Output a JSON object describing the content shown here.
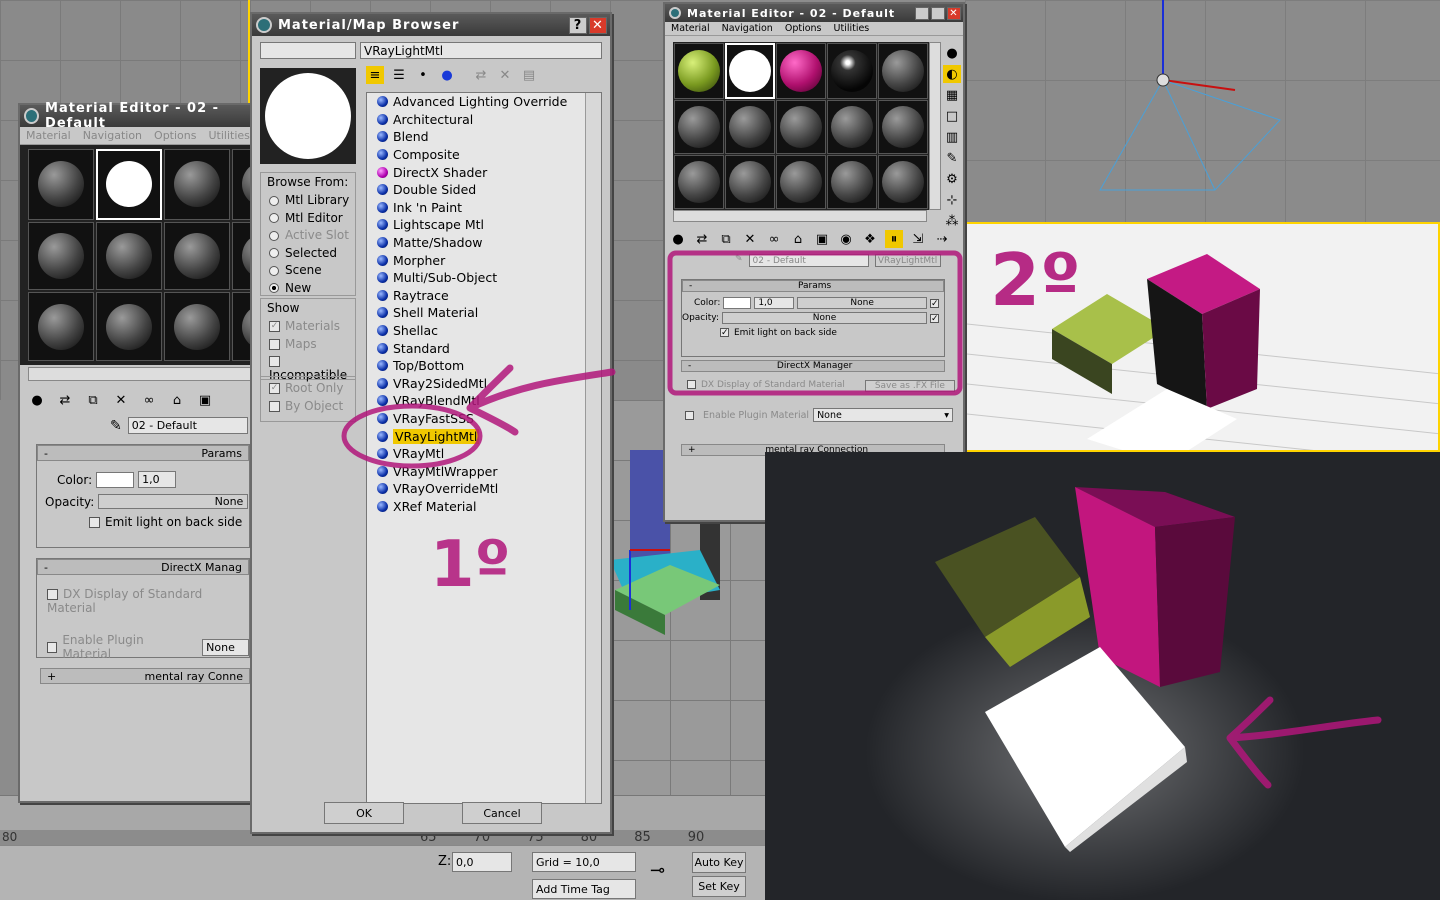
{
  "left_editor": {
    "title": "Material Editor - 02 - Default",
    "menus": [
      "Material",
      "Navigation",
      "Options",
      "Utilities"
    ],
    "material_name": "02 - Default",
    "params_label": "Params",
    "color_label": "Color:",
    "color_value": "1,0",
    "opacity_label": "Opacity:",
    "opacity_value": "None",
    "emit_label": "Emit light on back side",
    "directx_label": "DirectX Manag",
    "dx_display_label": "DX Display of Standard Material",
    "enable_plugin_label": "Enable Plugin Material",
    "plugin_value": "None",
    "mentalray_label": "mental ray Conne"
  },
  "browser": {
    "title": "Material/Map Browser",
    "name_field": "VRayLightMtl",
    "browse_from_label": "Browse From:",
    "browse_options": [
      {
        "label": "Mtl Library",
        "on": false,
        "dis": false
      },
      {
        "label": "Mtl Editor",
        "on": false,
        "dis": false
      },
      {
        "label": "Active Slot",
        "on": false,
        "dis": true
      },
      {
        "label": "Selected",
        "on": false,
        "dis": false
      },
      {
        "label": "Scene",
        "on": false,
        "dis": false
      },
      {
        "label": "New",
        "on": true,
        "dis": false
      }
    ],
    "show_label": "Show",
    "show_options": [
      {
        "label": "Materials",
        "checked": true,
        "dis": true
      },
      {
        "label": "Maps",
        "checked": false,
        "dis": true
      },
      {
        "label": "Incompatible",
        "checked": false,
        "dis": false
      }
    ],
    "extra_options": [
      {
        "label": "Root Only",
        "checked": true,
        "dis": true
      },
      {
        "label": "By Object",
        "checked": false,
        "dis": true
      }
    ],
    "items": [
      {
        "label": "Advanced Lighting Override",
        "mag": false
      },
      {
        "label": "Architectural",
        "mag": false
      },
      {
        "label": "Blend",
        "mag": false
      },
      {
        "label": "Composite",
        "mag": false
      },
      {
        "label": "DirectX Shader",
        "mag": true
      },
      {
        "label": "Double Sided",
        "mag": false
      },
      {
        "label": "Ink 'n Paint",
        "mag": false
      },
      {
        "label": "Lightscape Mtl",
        "mag": false
      },
      {
        "label": "Matte/Shadow",
        "mag": false
      },
      {
        "label": "Morpher",
        "mag": false
      },
      {
        "label": "Multi/Sub-Object",
        "mag": false
      },
      {
        "label": "Raytrace",
        "mag": false
      },
      {
        "label": "Shell Material",
        "mag": false
      },
      {
        "label": "Shellac",
        "mag": false
      },
      {
        "label": "Standard",
        "mag": false
      },
      {
        "label": "Top/Bottom",
        "mag": false
      },
      {
        "label": "VRay2SidedMtl",
        "mag": false
      },
      {
        "label": "VRayBlendMtl",
        "mag": false
      },
      {
        "label": "VRayFastSSS",
        "mag": false
      },
      {
        "label": "VRayLightMtl",
        "mag": false
      },
      {
        "label": "VRayMtl",
        "mag": false
      },
      {
        "label": "VRayMtlWrapper",
        "mag": false
      },
      {
        "label": "VRayOverrideMtl",
        "mag": false
      },
      {
        "label": "XRef Material",
        "mag": false
      }
    ],
    "selected_index": 19,
    "ok_label": "OK",
    "cancel_label": "Cancel"
  },
  "right_editor": {
    "title": "Material Editor - 02 - Default",
    "menus": [
      "Material",
      "Navigation",
      "Options",
      "Utilities"
    ],
    "material_name": "02 - Default",
    "type_label": "VRayLightMtl",
    "params_label": "Params",
    "color_label": "Color:",
    "color_value": "1,0",
    "color_map": "None",
    "opacity_label": "Opacity:",
    "opacity_map": "None",
    "emit_label": "Emit light on back side",
    "directx_label": "DirectX Manager",
    "dx_display_label": "DX Display of Standard Material",
    "save_fx_label": "Save as .FX File",
    "enable_plugin_label": "Enable Plugin Material",
    "plugin_value": "None",
    "mentalray_label": "mental ray Connection"
  },
  "timeline": {
    "ticks": [
      "65",
      "70",
      "75",
      "80",
      "85",
      "90"
    ],
    "z_label": "Z:",
    "z_value": "0,0",
    "grid_label": "Grid = 10,0",
    "auto_key": "Auto Key",
    "set_key": "Set Key",
    "add_time_tag": "Add Time Tag",
    "left_tick": "80"
  },
  "annotations": {
    "step1": "1º",
    "step2": "2º",
    "color": "#b0167a"
  }
}
